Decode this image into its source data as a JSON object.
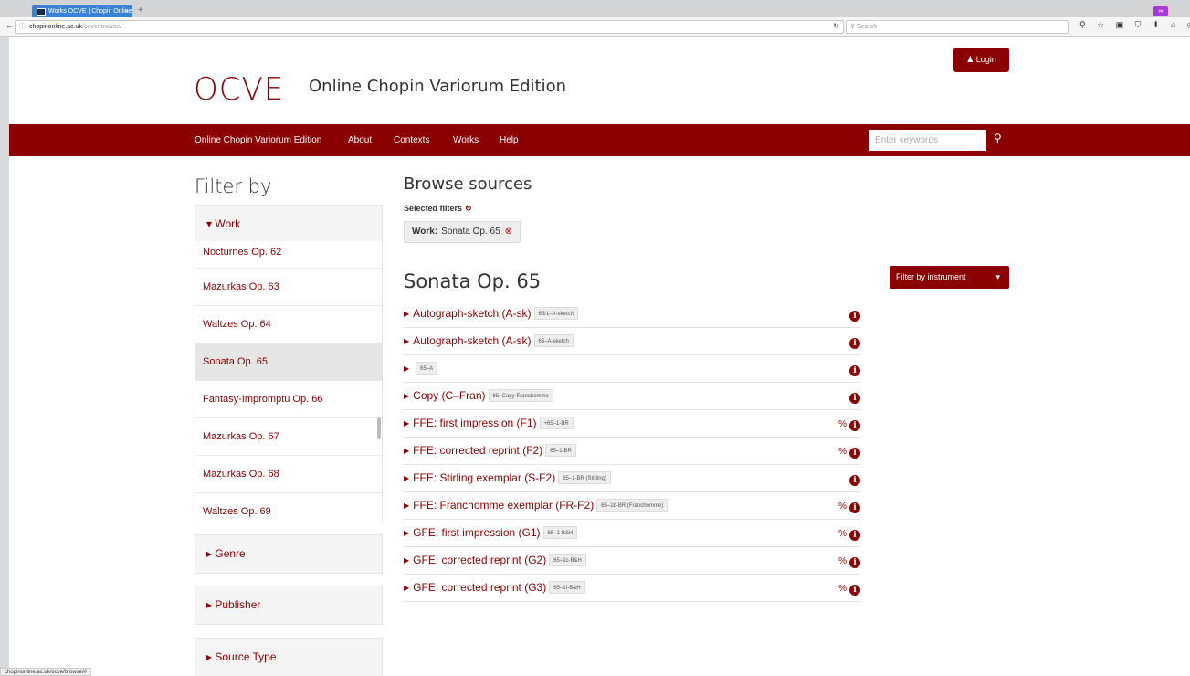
{
  "browser": {
    "tab_title": "Works OCVE | Chopin Online",
    "tab_close": "×",
    "new_tab": "+",
    "url_domain": "chopinonline.ac.uk",
    "url_path": "/ocve/browse/",
    "search_placeholder": "Search",
    "toolbar_icons": "⚲ ☆ ▣ ⛉ ⬇ ⌂ ◎ ≡",
    "status_url": "chopinonline.ac.uk/ocve/browse/#"
  },
  "header": {
    "logo": "OCVE",
    "subtitle": "Online Chopin Variorum Edition",
    "login_label": "♟ Login"
  },
  "nav": {
    "items": [
      "Online Chopin Variorum Edition",
      "About",
      "Contexts",
      "Works",
      "Help"
    ],
    "search_placeholder": "Enter keywords"
  },
  "sidebar": {
    "title": "Filter by",
    "work_panel": "▾ Work",
    "works": [
      "Nocturnes Op. 62",
      "Mazurkas Op. 63",
      "Waltzes Op. 64",
      "Sonata Op. 65",
      "Fantasy-Impromptu Op. 66",
      "Mazurkas Op. 67",
      "Mazurkas Op. 68",
      "Waltzes Op. 69"
    ],
    "active_work": "Sonata Op. 65",
    "panels": [
      "▸ Genre",
      "▸ Publisher",
      "▸ Source Type"
    ]
  },
  "main": {
    "title": "Browse sources",
    "selected_filters_label": "Selected filters",
    "chip_label": "Work:",
    "chip_value": "Sonata Op. 65",
    "instrument_button": "Filter by instrument",
    "work_title": "Sonata Op. 65",
    "sources": [
      {
        "name": "Autograph-sketch (A-sk)",
        "code": "65/1–A-sketch",
        "link": false
      },
      {
        "name": "Autograph-sketch (A-sk)",
        "code": "65–A-sketch",
        "link": false
      },
      {
        "name": "",
        "code": "65–A",
        "link": false
      },
      {
        "name": "Copy (C–Fran)",
        "code": "65–Copy-Franchomme",
        "link": false
      },
      {
        "name": "FFE: first impression (F1)",
        "code": "+65–1-BR",
        "link": true
      },
      {
        "name": "FFE: corrected reprint (F2)",
        "code": "65–1-BR",
        "link": true
      },
      {
        "name": "FFE: Stirling exemplar (S-F2)",
        "code": "65–1-BR (Stirling)",
        "link": false
      },
      {
        "name": "FFE: Franchomme exemplar (FR-F2)",
        "code": "65–1b-BR (Franchomme)",
        "link": true
      },
      {
        "name": "GFE: first impression (G1)",
        "code": "65–1-B&H",
        "link": true
      },
      {
        "name": "GFE: corrected reprint (G2)",
        "code": "65–1c-B&H",
        "link": true
      },
      {
        "name": "GFE: corrected reprint (G3)",
        "code": "65–1f-B&H",
        "link": true
      }
    ]
  },
  "colors": {
    "brand": "#8b0000"
  }
}
